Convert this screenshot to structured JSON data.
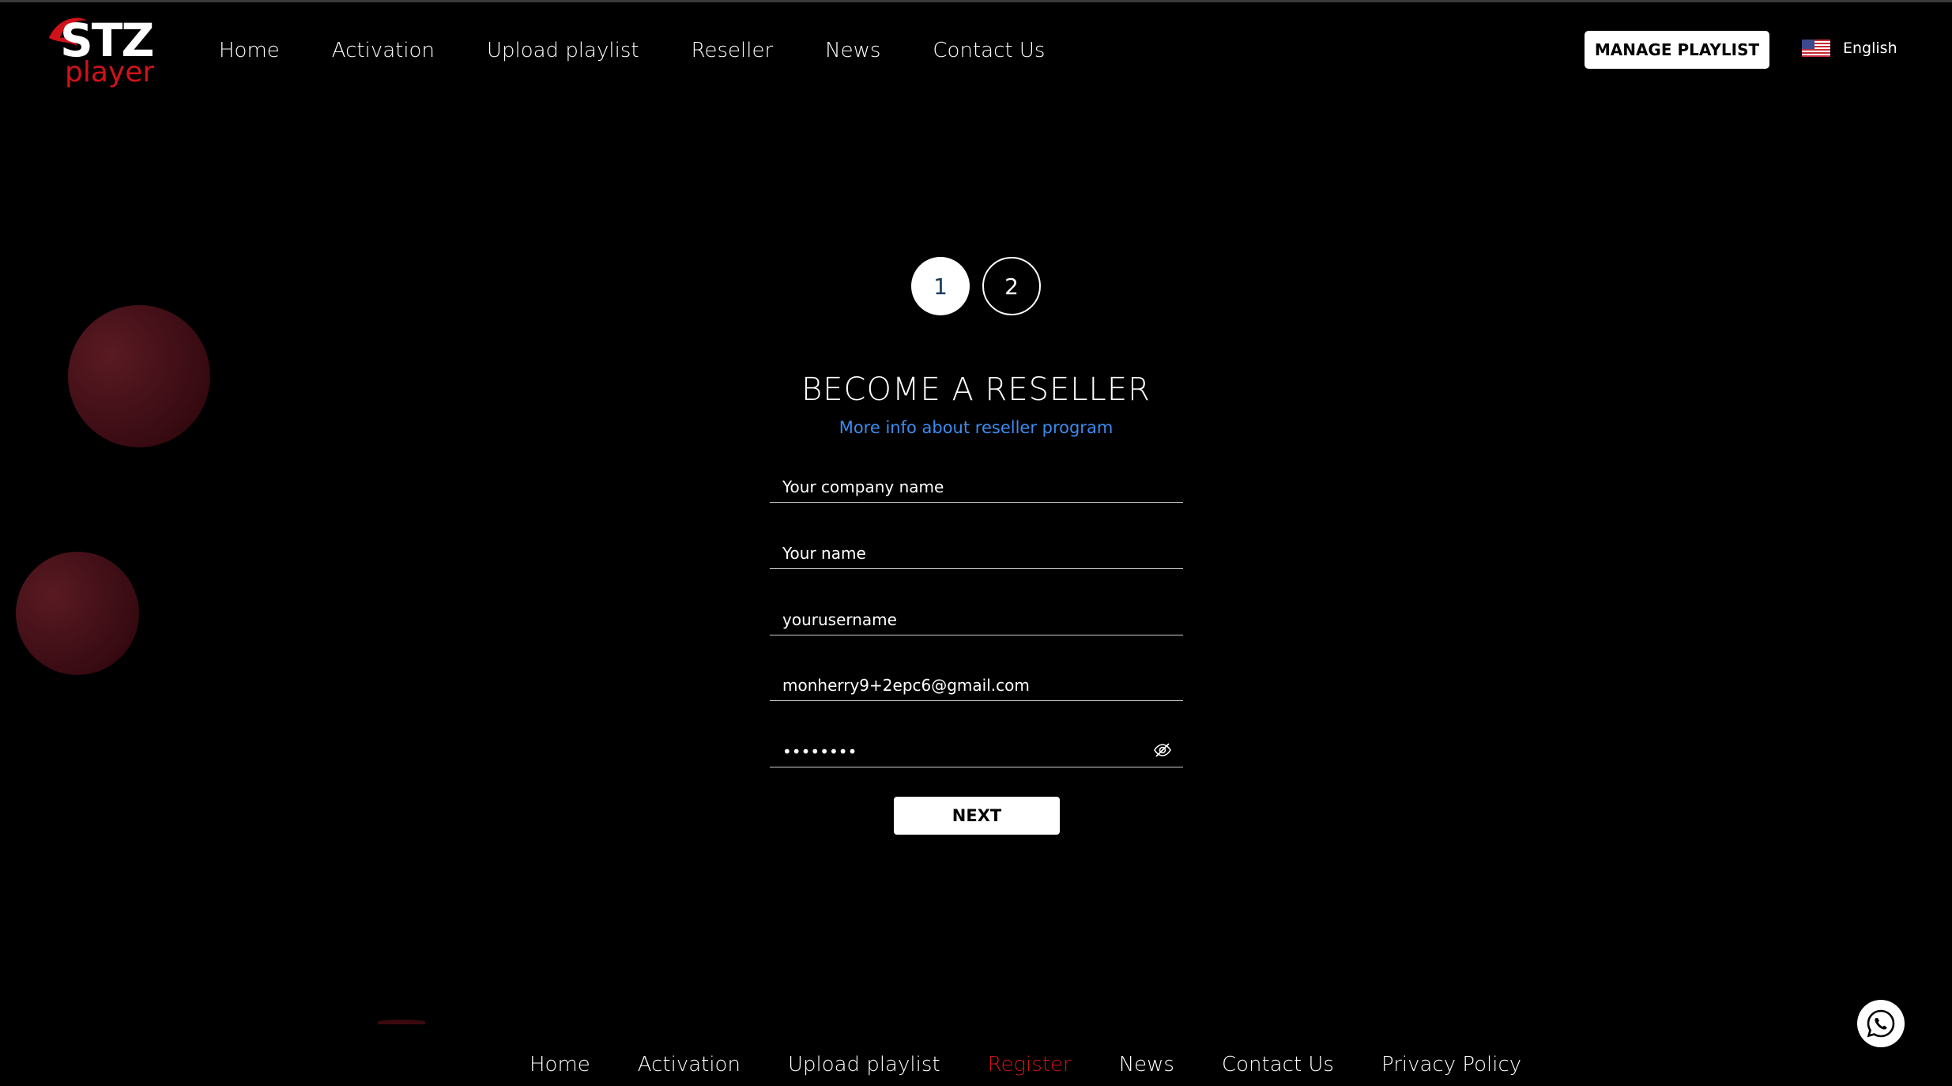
{
  "brand": {
    "logo_main": "STZ",
    "logo_sub": "player",
    "accent": "#d0121b"
  },
  "header": {
    "nav": [
      "Home",
      "Activation",
      "Upload playlist",
      "Reseller",
      "News",
      "Contact Us"
    ],
    "manage_label": "MANAGE PLAYLIST",
    "language": "English",
    "flag_icon": "us-flag-icon"
  },
  "steps": [
    "1",
    "2"
  ],
  "form": {
    "title": "BECOME A RESELLER",
    "info_link": "More info about reseller program",
    "company_placeholder": "Your company name",
    "name_placeholder": "Your name",
    "username_value": "yourusername",
    "email_value": "monherry9+2epc6@gmail.com",
    "password_value": "••••••••",
    "next_label": "NEXT"
  },
  "footer": {
    "nav": [
      "Home",
      "Activation",
      "Upload playlist",
      "Register",
      "News",
      "Contact Us",
      "Privacy Policy"
    ],
    "active_index": 3
  },
  "link_color": "#3b8cf0"
}
